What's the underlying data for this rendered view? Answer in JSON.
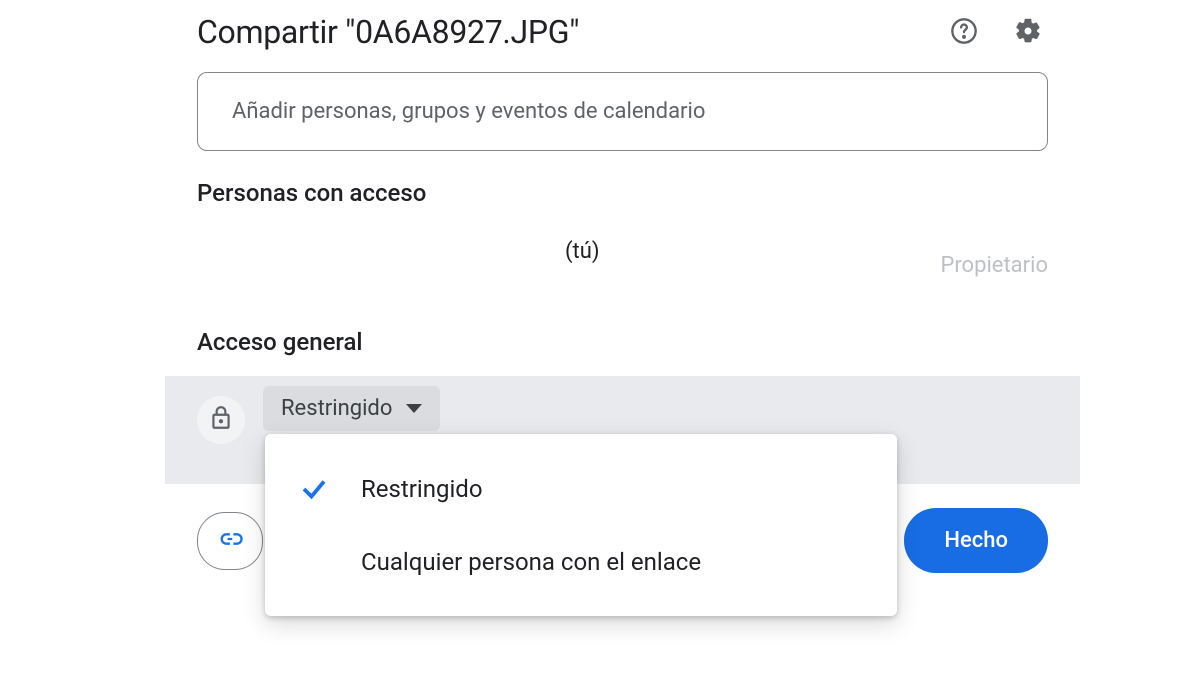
{
  "dialog": {
    "title": "Compartir \"0A6A8927.JPG\"",
    "add_people_placeholder": "Añadir personas, grupos y eventos de calendario"
  },
  "sections": {
    "people_with_access": "Personas con acceso",
    "general_access": "Acceso general"
  },
  "people": [
    {
      "you_suffix": "(tú)",
      "role": "Propietario"
    }
  ],
  "access": {
    "selected": "Restringido",
    "options": [
      "Restringido",
      "Cualquier persona con el enlace"
    ]
  },
  "footer": {
    "done": "Hecho"
  }
}
